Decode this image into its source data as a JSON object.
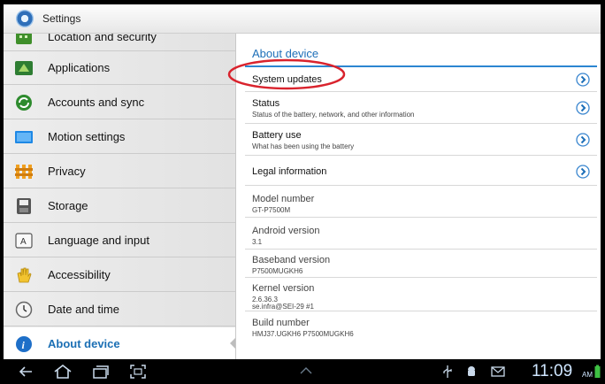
{
  "window": {
    "title": "Settings"
  },
  "sidebar": {
    "items": [
      {
        "label": "Location and security",
        "icon": "location-security-icon"
      },
      {
        "label": "Applications",
        "icon": "applications-icon"
      },
      {
        "label": "Accounts and sync",
        "icon": "accounts-sync-icon"
      },
      {
        "label": "Motion settings",
        "icon": "motion-icon"
      },
      {
        "label": "Privacy",
        "icon": "privacy-icon"
      },
      {
        "label": "Storage",
        "icon": "storage-icon"
      },
      {
        "label": "Language and input",
        "icon": "language-icon"
      },
      {
        "label": "Accessibility",
        "icon": "accessibility-icon"
      },
      {
        "label": "Date and time",
        "icon": "clock-icon"
      },
      {
        "label": "About device",
        "icon": "info-icon",
        "selected": true
      }
    ]
  },
  "main": {
    "title": "About device",
    "rows": [
      {
        "title": "System updates",
        "sub": "",
        "arrow": true
      },
      {
        "title": "Status",
        "sub": "Status of the battery, network, and other information",
        "arrow": true
      },
      {
        "title": "Battery use",
        "sub": "What has been using the battery",
        "arrow": true
      },
      {
        "title": "Legal information",
        "sub": "",
        "arrow": true
      },
      {
        "title": "Model number",
        "sub": "GT-P7500M"
      },
      {
        "title": "Android version",
        "sub": "3.1"
      },
      {
        "title": "Baseband version",
        "sub": "P7500MUGKH6"
      },
      {
        "title": "Kernel version",
        "sub": "2.6.36.3",
        "sub2": "se.infra@SEI-29 #1"
      },
      {
        "title": "Build number",
        "sub": "HMJ37.UGKH6 P7500MUGKH6"
      }
    ]
  },
  "statusbar": {
    "time": "11:09",
    "ampm": "AM"
  },
  "colors": {
    "accent": "#1d6fb8",
    "highlight": "#d9232d"
  }
}
